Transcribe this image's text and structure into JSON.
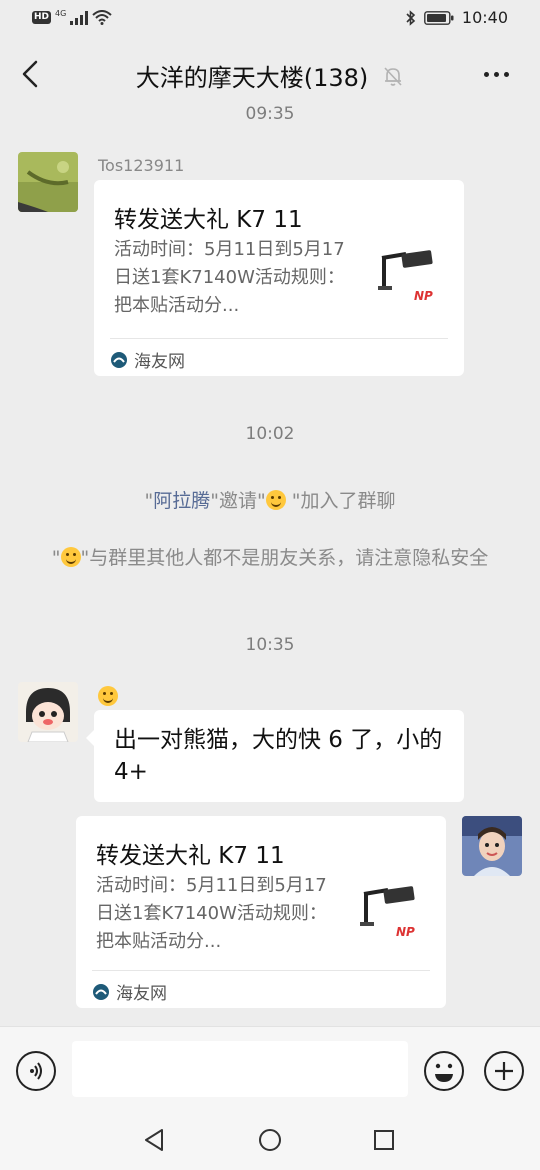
{
  "status_bar": {
    "hd_badge": "HD",
    "network_label": "4G",
    "time": "10:40"
  },
  "header": {
    "title": "大洋的摩天大楼(138)"
  },
  "messages": {
    "ts_top": "09:35",
    "msg1": {
      "sender": "Tos123911",
      "card_title": "转发送大礼 K7 11",
      "card_desc": "活动时间：5月11日到5月17日送1套K7140W活动规则：把本贴活动分...",
      "card_source": "海友网"
    },
    "ts_1002": "10:02",
    "sys_join": {
      "quote_open": "\"",
      "inviter": "阿拉腾",
      "middle": "\"邀请\"",
      "end": " \"加入了群聊"
    },
    "sys_privacy": {
      "quote_open": "\"",
      "text": "\"与群里其他人都不是朋友关系，请注意隐私安全"
    },
    "ts_1035": "10:35",
    "msg2": {
      "text": "出一对熊猫，大的快 6 了，小的 4+"
    },
    "msg3": {
      "card_title": "转发送大礼 K7 11",
      "card_desc": "活动时间：5月11日到5月17日送1套K7140W活动规则：把本贴活动分...",
      "card_source": "海友网"
    }
  },
  "input_bar": {
    "value": ""
  },
  "colors": {
    "background": "#ededed",
    "bubble": "#ffffff",
    "link": "#576b95",
    "timestamp": "#7d7d7d"
  }
}
